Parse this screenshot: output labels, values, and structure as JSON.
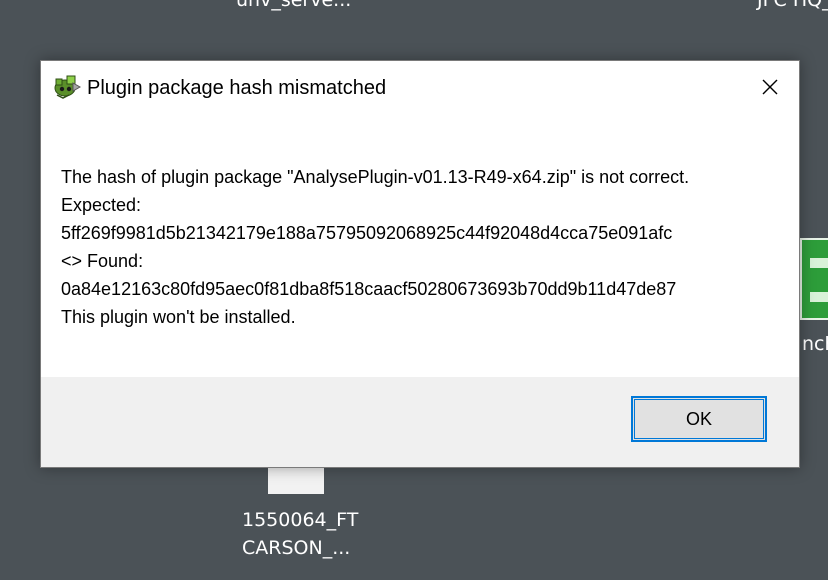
{
  "desktop": {
    "top_left_label": "unv_serve...",
    "top_right_label": "JFC HQ_",
    "right_label": "nch",
    "bottom_label_line1": "1550064_FT",
    "bottom_label_line2": "CARSON_..."
  },
  "dialog": {
    "title": "Plugin package hash mismatched",
    "close_icon": "close-icon",
    "app_icon": "plugin-icon",
    "message_lines": [
      "The hash of plugin package \"AnalysePlugin-v01.13-R49-x64.zip\" is not correct.",
      "Expected:",
      "5ff269f9981d5b21342179e188a75795092068925c44f92048d4cca75e091afc",
      "<> Found:",
      "0a84e12163c80fd95aec0f81dba8f518caacf50280673693b70dd9b11d47de87",
      "This plugin won't be installed."
    ],
    "ok_label": "OK"
  },
  "colors": {
    "desktop_bg": "#4b5257",
    "dialog_footer": "#f0f0f0",
    "button_border": "#0078d7"
  }
}
